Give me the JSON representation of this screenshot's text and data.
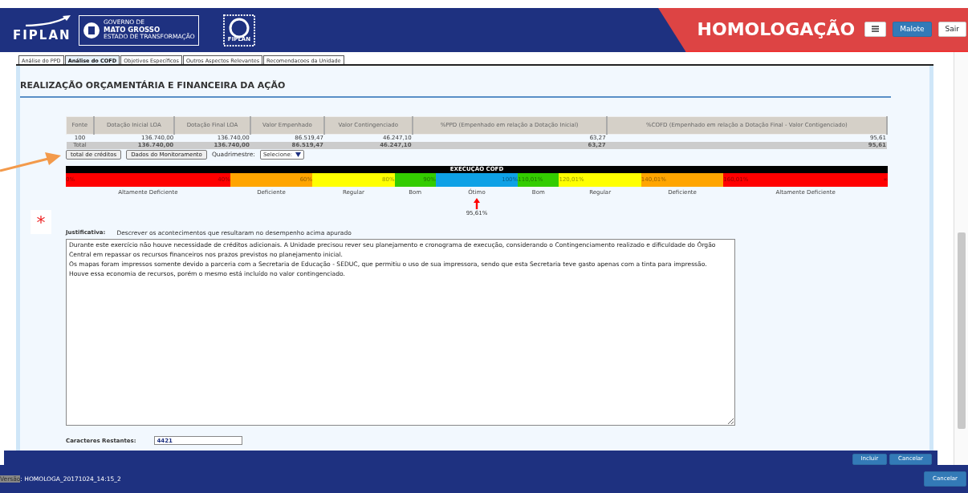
{
  "header": {
    "logo_text": "FIPLAN",
    "gov_lines": [
      "GOVERNO DE",
      "MATO GROSSO",
      "ESTADO DE TRANSFORMAÇÃO"
    ],
    "stamp_text": "FIPLAN",
    "environment": "HOMOLOGAÇÃO",
    "buttons": [
      {
        "label": "Malote",
        "kind": "primary"
      },
      {
        "label": "Sair",
        "kind": "light"
      }
    ]
  },
  "tabs": [
    {
      "label": "Análise do PPD",
      "selected": false
    },
    {
      "label": "Análise do COFD",
      "selected": true
    },
    {
      "label": "Objetivos Específicos",
      "selected": false
    },
    {
      "label": "Outros Aspectos Relevantes",
      "selected": false
    },
    {
      "label": "Recomendacoes da Unidade",
      "selected": false
    }
  ],
  "section_title": "REALIZAÇÃO ORÇAMENTÁRIA E FINANCEIRA DA AÇÃO",
  "table": {
    "columns": [
      "Fonte",
      "Dotação Inicial LOA",
      "Dotação Final LOA",
      "Valor Empenhado",
      "Valor Contingenciado",
      "%PPD (Empenhado em relação a Dotação Inicial)",
      "%COFD (Empenhado em relação a Dotação Final - Valor Contigenciado)"
    ],
    "rows": [
      {
        "kind": "data",
        "cells": [
          "100",
          "136.740,00",
          "136.740,00",
          "86.519,47",
          "46.247,10",
          "63,27",
          "95,61"
        ]
      },
      {
        "kind": "total",
        "cells": [
          "Total",
          "136.740,00",
          "136.740,00",
          "86.519,47",
          "46.247,10",
          "63,27",
          "95,61"
        ]
      }
    ]
  },
  "actions": {
    "buttons": [
      "total de créditos",
      "Dados do Monitoramento"
    ],
    "quadrimestre_label": "Quadrimestre:",
    "quadrimestre_value": "Selecione:"
  },
  "scale": {
    "title": "EXECUÇÃO COFD",
    "reading": "95,61%",
    "segments": [
      {
        "start": "0%",
        "end": "40%",
        "label": "Altamente Deficiente",
        "color": "#ff0000",
        "selected": false
      },
      {
        "end": "60%",
        "label": "Deficiente",
        "color": "#ffa500",
        "selected": false
      },
      {
        "end": "80%",
        "label": "Regular",
        "color": "#ffff00",
        "selected": false
      },
      {
        "end": "90%",
        "label": "Bom",
        "color": "#33cc00",
        "selected": false
      },
      {
        "end": "100%",
        "label": "Ótimo",
        "color": "#0ea1e6",
        "selected": true
      },
      {
        "start": "110,01%",
        "label": "Bom",
        "color": "#33cc00",
        "selected": false
      },
      {
        "start": "120,01%",
        "label": "Regular",
        "color": "#ffff00",
        "selected": false
      },
      {
        "start": "140,01%",
        "label": "Deficiente",
        "color": "#ffa500",
        "selected": false
      },
      {
        "start": "160,01%",
        "end": "∞",
        "label": "Altamente Deficiente",
        "color": "#ff0000",
        "selected": false
      }
    ]
  },
  "justification": {
    "required_mark": "*",
    "label": "Justificativa:",
    "hint": "Descrever os acontecimentos que resultaram no desempenho acima apurado",
    "value": "Durante este exercício não houve necessidade de créditos adicionais. A Unidade precisou rever seu planejamento e cronograma de execução, considerando o Contingenciamento realizado e dificuldade do Órgão Central em repassar os recursos financeiros nos prazos previstos no planejamento inicial.\nOs mapas foram impressos somente devido a parceria com a Secretaria de Educação - SEDUC, que permitiu o uso de sua impressora, sendo que esta Secretaria teve gasto apenas com a tinta para impressão.\nHouve essa economia de recursos, porém o mesmo está incluído no valor contingenciado."
  },
  "remaining": {
    "label": "Caracteres Restantes:",
    "value": "4421"
  },
  "form_buttons": [
    "Incluir",
    "Cancelar"
  ],
  "status_bar": {
    "highlighted_text": "Versão",
    "text": ": HOMOLOGA_20171024_14:15_2",
    "button": "Cancelar"
  }
}
